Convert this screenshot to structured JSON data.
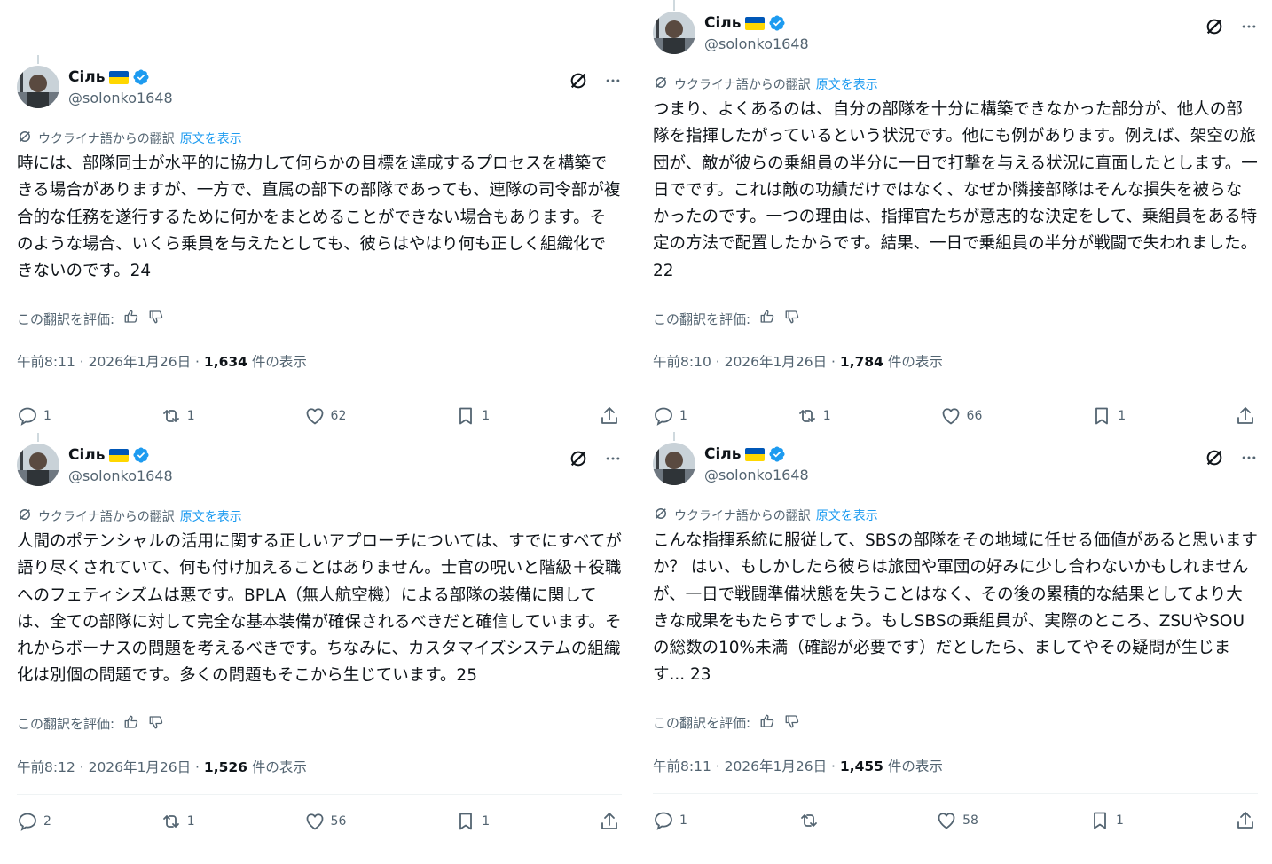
{
  "author": {
    "display_name": "Сіль",
    "handle": "@solonko1648"
  },
  "translation_label": "ウクライナ語からの翻訳",
  "show_original_label": "原文を表示",
  "rate_label": "この翻訳を評価:",
  "views_suffix": "件の表示",
  "colors": {
    "accent": "#1d9bf0",
    "flag_blue": "#0057b7",
    "flag_yellow": "#ffd700",
    "muted": "#536471"
  },
  "icons": [
    "grok-icon",
    "more-icon",
    "translate-icon",
    "thumbs-up-icon",
    "thumbs-down-icon",
    "reply-icon",
    "repost-icon",
    "like-icon",
    "bookmark-icon",
    "share-icon",
    "verified-badge-icon"
  ],
  "posts": [
    {
      "text": "時には、部隊同士が水平的に協力して何らかの目標を達成するプロセスを構築できる場合がありますが、一方で、直属の部下の部隊であっても、連隊の司令部が複合的な任務を遂行するために何かをまとめることができない場合もあります。そのような場合、いくら乗員を与えたとしても、彼らはやはり何も正しく組織化できないのです。24",
      "time": "午前8:11 · 2026年1月26日 · ",
      "views": "1,634",
      "replies": "1",
      "reposts": "1",
      "likes": "62",
      "bookmarks": "1"
    },
    {
      "text": "つまり、よくあるのは、自分の部隊を十分に構築できなかった部分が、他人の部隊を指揮したがっているという状況です。他にも例があります。例えば、架空の旅団が、敵が彼らの乗組員の半分に一日で打撃を与える状況に直面したとします。一日でです。これは敵の功績だけではなく、なぜか隣接部隊はそんな損失を被らなかったのです。一つの理由は、指揮官たちが意志的な決定をして、乗組員をある特定の方法で配置したからです。結果、一日で乗組員の半分が戦闘で失われました。22",
      "time": "午前8:10 · 2026年1月26日 · ",
      "views": "1,784",
      "replies": "1",
      "reposts": "1",
      "likes": "66",
      "bookmarks": "1"
    },
    {
      "text": "人間のポテンシャルの活用に関する正しいアプローチについては、すでにすべてが語り尽くされていて、何も付け加えることはありません。士官の呪いと階級＋役職へのフェティシズムは悪です。BPLA（無人航空機）による部隊の装備に関しては、全ての部隊に対して完全な基本装備が確保されるべきだと確信しています。それからボーナスの問題を考えるべきです。ちなみに、カスタマイズシステムの組織化は別個の問題です。多くの問題もそこから生じています。25",
      "time": "午前8:12 · 2026年1月26日 · ",
      "views": "1,526",
      "replies": "2",
      "reposts": "1",
      "likes": "56",
      "bookmarks": "1"
    },
    {
      "text": "こんな指揮系統に服従して、SBSの部隊をその地域に任せる価値があると思いますか？ はい、もしかしたら彼らは旅団や軍団の好みに少し合わないかもしれませんが、一日で戦闘準備状態を失うことはなく、その後の累積的な結果としてより大きな成果をもたらすでしょう。もしSBSの乗組員が、実際のところ、ZSUやSOUの総数の10%未満（確認が必要です）だとしたら、ましてやその疑問が生じます... 23",
      "time": "午前8:11 · 2026年1月26日 · ",
      "views": "1,455",
      "replies": "1",
      "reposts": "",
      "likes": "58",
      "bookmarks": "1"
    }
  ]
}
